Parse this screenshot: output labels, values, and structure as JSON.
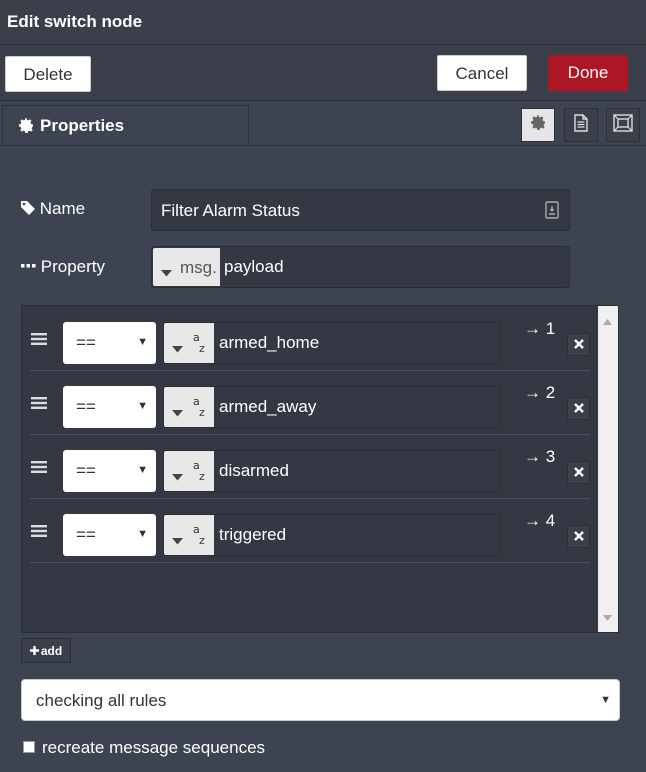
{
  "window": {
    "title": "Edit switch node"
  },
  "toolbar": {
    "delete_label": "Delete",
    "cancel_label": "Cancel",
    "done_label": "Done"
  },
  "tabs": {
    "properties_label": "Properties",
    "icons": [
      "gear-icon",
      "description-icon",
      "appearance-icon"
    ]
  },
  "form": {
    "name_label": "Name",
    "name_value": "Filter Alarm Status",
    "property_label": "Property",
    "property_type": "msg.",
    "property_value": "payload"
  },
  "rules": [
    {
      "operator": "==",
      "type_icon": "a-z",
      "value": "armed_home",
      "output": "→ 1"
    },
    {
      "operator": "==",
      "type_icon": "a-z",
      "value": "armed_away",
      "output": "→ 2"
    },
    {
      "operator": "==",
      "type_icon": "a-z",
      "value": "disarmed",
      "output": "→ 3"
    },
    {
      "operator": "==",
      "type_icon": "a-z",
      "value": "triggered",
      "output": "→ 4"
    }
  ],
  "add_label": "add",
  "check_mode": {
    "selected": "checking all rules"
  },
  "recreate_label": "recreate message sequences",
  "colors": {
    "done": "#ad1625",
    "background": "#3d4350"
  }
}
